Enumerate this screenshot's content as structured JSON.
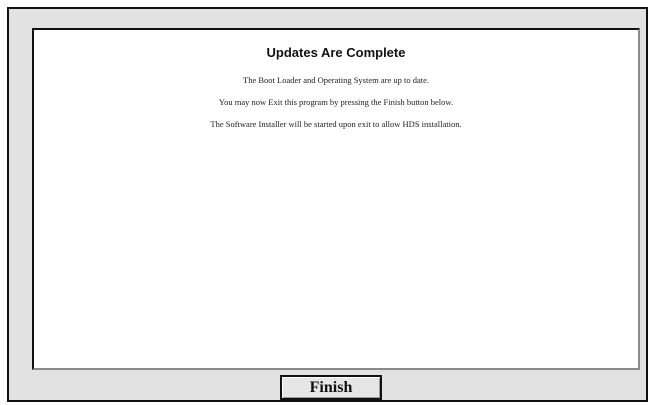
{
  "dialog": {
    "title": "Updates Are Complete",
    "messages": [
      "The Boot Loader and Operating System are up to date.",
      "You may now Exit this program by pressing the Finish button below.",
      "The Software Installer will be started upon exit to allow HDS installation."
    ],
    "finish_label": "Finish"
  }
}
